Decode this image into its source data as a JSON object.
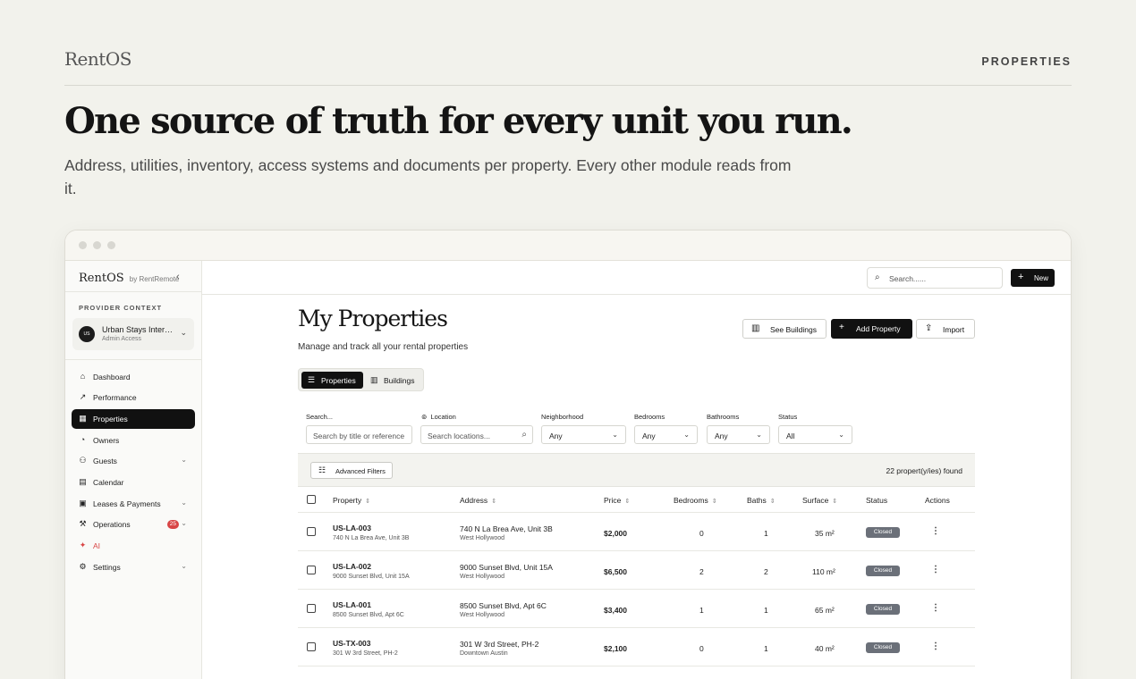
{
  "hero": {
    "brand": "RentOS",
    "nav_link": "PROPERTIES",
    "headline": "One source of truth for every unit you run.",
    "subline": "Address, utilities, inventory, access systems and documents per property. Every other module reads from it."
  },
  "sidebar": {
    "brand": "RentOS",
    "brand_suffix": "by RentRemote",
    "collapse_icon": "chevron-left-icon",
    "context_label": "PROVIDER CONTEXT",
    "provider": {
      "name": "Urban Stays International",
      "role": "Admin Access",
      "avatar_text": "URBAN STAYS"
    },
    "items": [
      {
        "label": "Dashboard",
        "icon": "home-icon",
        "glyph": "⌂"
      },
      {
        "label": "Performance",
        "icon": "trend-icon",
        "glyph": "↗"
      },
      {
        "label": "Properties",
        "icon": "building-icon",
        "glyph": "▦",
        "active": true
      },
      {
        "label": "Owners",
        "icon": "user-icon",
        "glyph": "◔"
      },
      {
        "label": "Guests",
        "icon": "users-icon",
        "glyph": "⚇",
        "expandable": true
      },
      {
        "label": "Calendar",
        "icon": "calendar-icon",
        "glyph": "▤"
      },
      {
        "label": "Leases & Payments",
        "icon": "document-icon",
        "glyph": "▣",
        "expandable": true
      },
      {
        "label": "Operations",
        "icon": "wrench-icon",
        "glyph": "⚒",
        "badge": "25",
        "expandable": true
      },
      {
        "label": "AI",
        "icon": "sparkle-icon",
        "glyph": "✦",
        "accent": "#d84545"
      },
      {
        "label": "Settings",
        "icon": "gear-icon",
        "glyph": "⚙",
        "expandable": true
      }
    ]
  },
  "topbar": {
    "search_placeholder": "Search......",
    "new_label": "New"
  },
  "page": {
    "title": "My Properties",
    "subtitle": "Manage and track all your rental properties",
    "actions": {
      "see_buildings": "See Buildings",
      "add_property": "Add Property",
      "import": "Import"
    },
    "tabs": [
      "Properties",
      "Buildings"
    ]
  },
  "filters": {
    "search_label": "Search...",
    "search_placeholder": "Search by title or reference",
    "location_label": "Location",
    "location_placeholder": "Search locations...",
    "neighborhood_label": "Neighborhood",
    "neighborhood_value": "Any",
    "bedrooms_label": "Bedrooms",
    "bedrooms_value": "Any",
    "bathrooms_label": "Bathrooms",
    "bathrooms_value": "Any",
    "status_label": "Status",
    "status_value": "All",
    "advanced_label": "Advanced Filters",
    "result_count": "22 propert(y/ies) found"
  },
  "table": {
    "columns": [
      "Property",
      "Address",
      "Price",
      "Bedrooms",
      "Baths",
      "Surface",
      "Status",
      "Actions"
    ],
    "rows": [
      {
        "ref": "US-LA-003",
        "ref_sub": "740 N La Brea Ave, Unit 3B",
        "address": "740 N La Brea Ave, Unit 3B",
        "area": "West Hollywood",
        "price": "$2,000",
        "bedrooms": "0",
        "baths": "1",
        "surface": "35 m²",
        "status": "Closed"
      },
      {
        "ref": "US-LA-002",
        "ref_sub": "9000 Sunset Blvd, Unit 15A",
        "address": "9000 Sunset Blvd, Unit 15A",
        "area": "West Hollywood",
        "price": "$6,500",
        "bedrooms": "2",
        "baths": "2",
        "surface": "110 m²",
        "status": "Closed"
      },
      {
        "ref": "US-LA-001",
        "ref_sub": "8500 Sunset Blvd, Apt 6C",
        "address": "8500 Sunset Blvd, Apt 6C",
        "area": "West Hollywood",
        "price": "$3,400",
        "bedrooms": "1",
        "baths": "1",
        "surface": "65 m²",
        "status": "Closed"
      },
      {
        "ref": "US-TX-003",
        "ref_sub": "301 W 3rd Street, PH-2",
        "address": "301 W 3rd Street, PH-2",
        "area": "Downtown Austin",
        "price": "$2,100",
        "bedrooms": "0",
        "baths": "1",
        "surface": "40 m²",
        "status": "Closed"
      }
    ]
  }
}
